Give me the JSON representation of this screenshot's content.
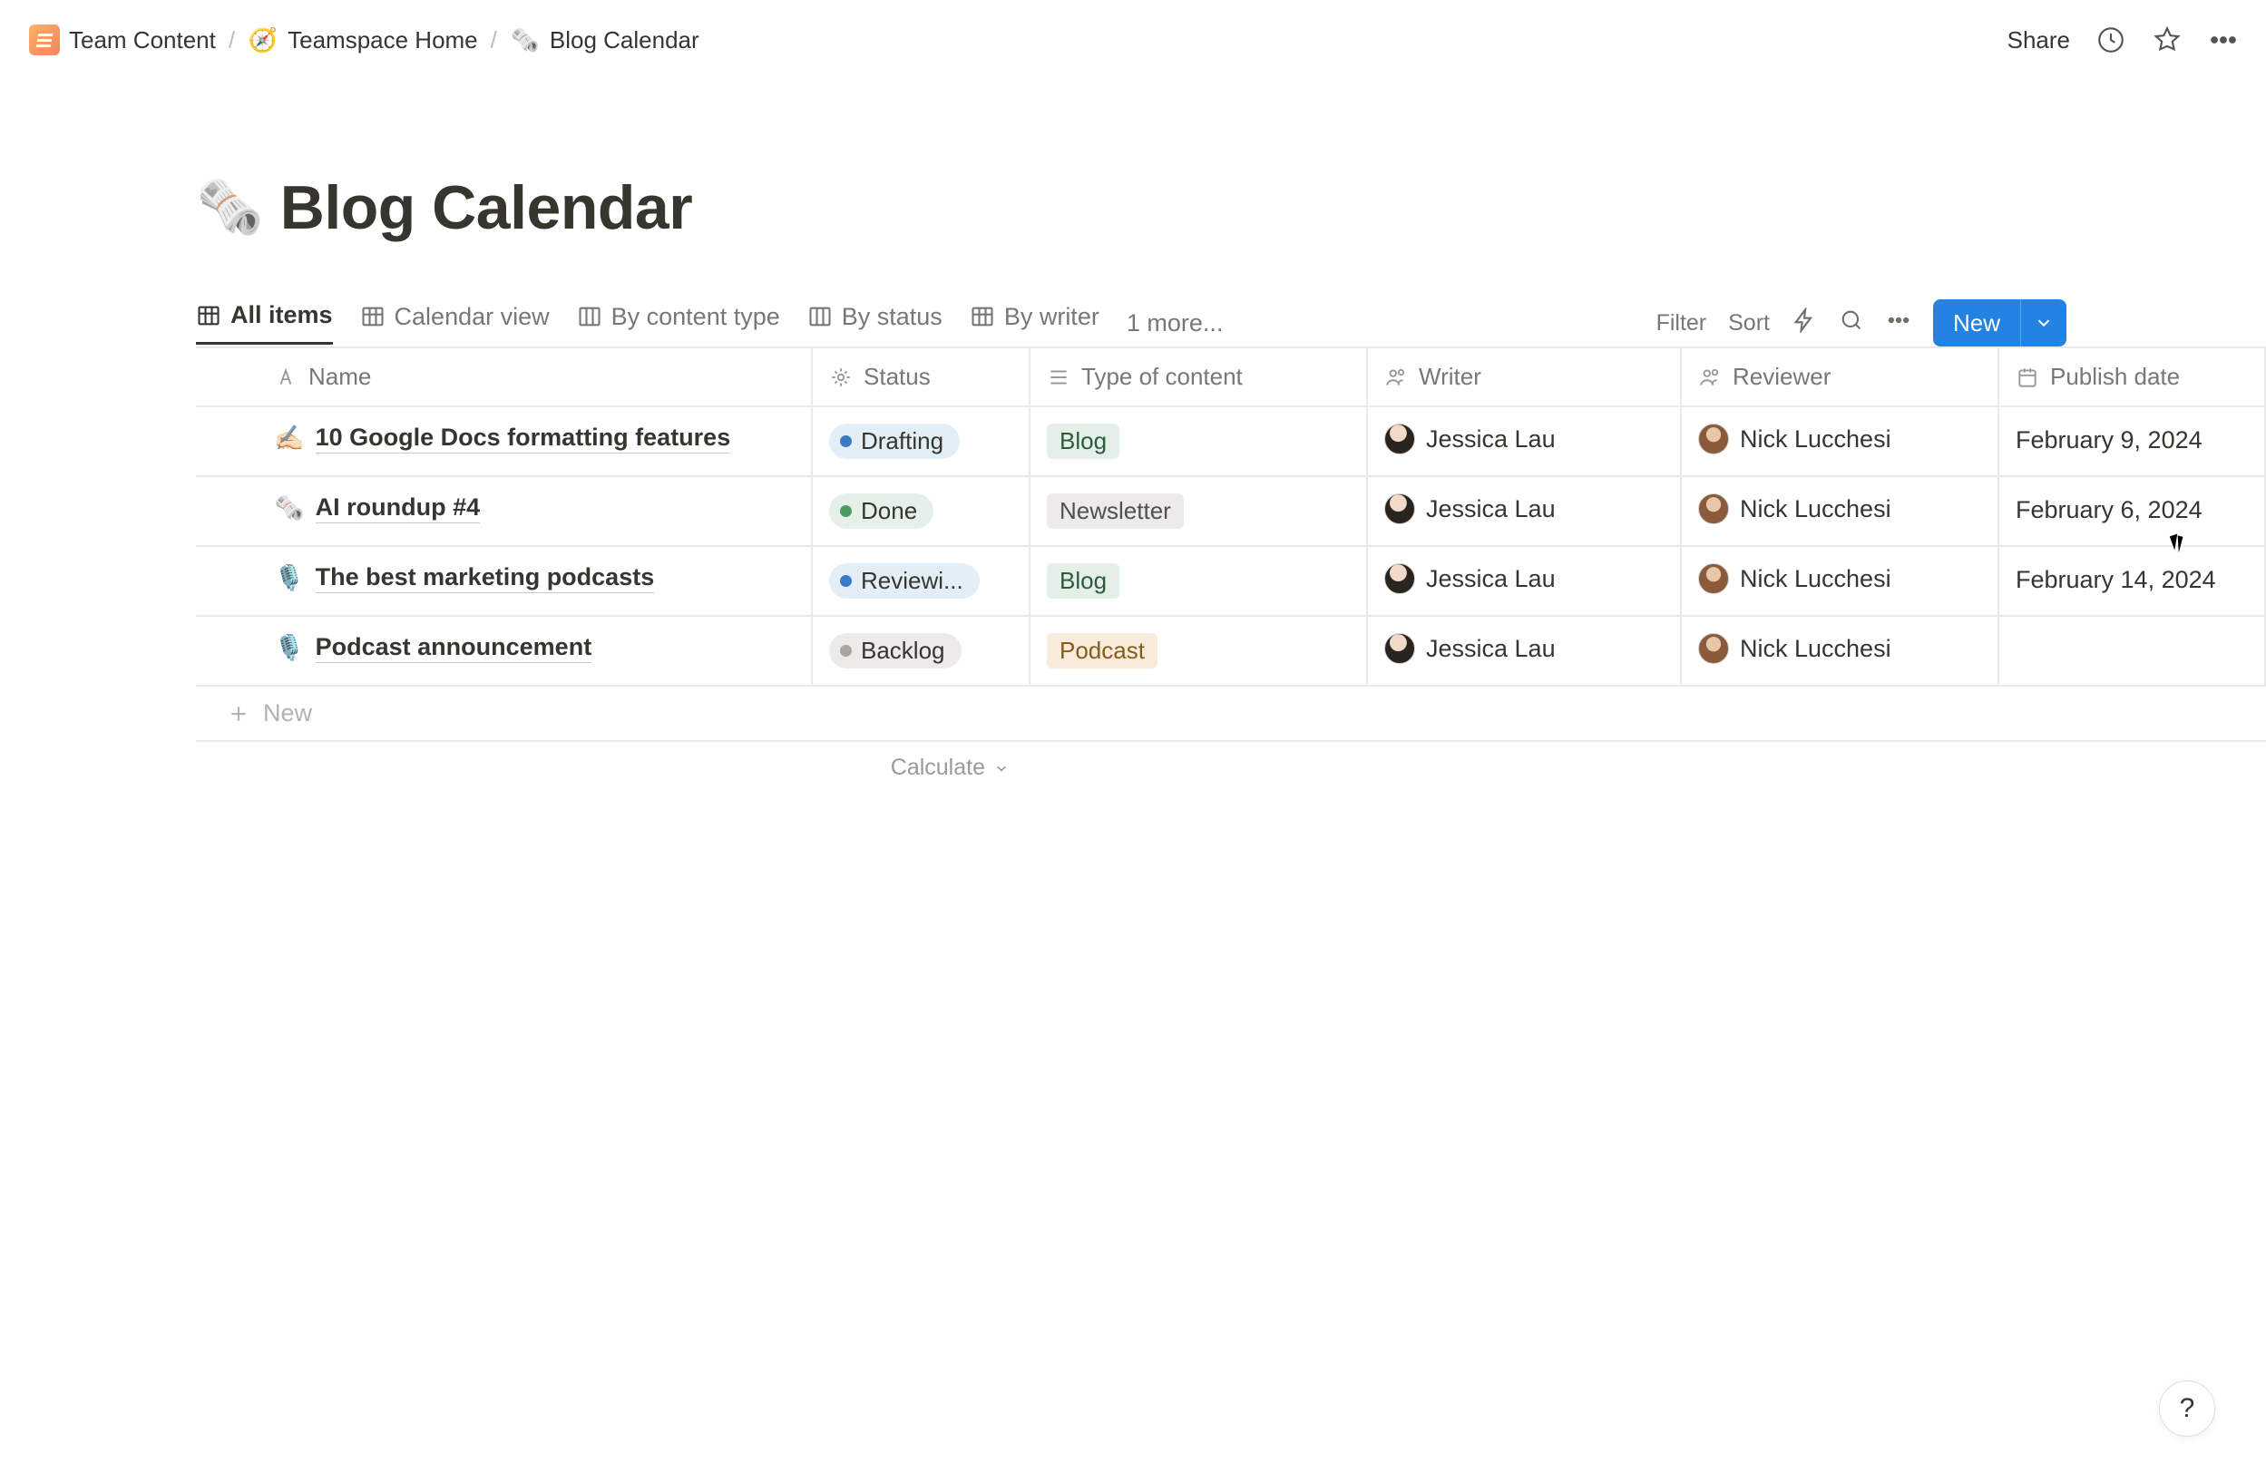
{
  "breadcrumb": {
    "items": [
      {
        "label": "Team Content",
        "icon": "workspace"
      },
      {
        "label": "Teamspace Home",
        "icon": "compass"
      },
      {
        "label": "Blog Calendar",
        "icon": "newspaper"
      }
    ]
  },
  "topbar": {
    "share": "Share"
  },
  "page": {
    "emoji": "🗞️",
    "title": "Blog Calendar"
  },
  "views": {
    "tabs": [
      {
        "label": "All items",
        "icon": "table",
        "active": true
      },
      {
        "label": "Calendar view",
        "icon": "table",
        "active": false
      },
      {
        "label": "By content type",
        "icon": "board",
        "active": false
      },
      {
        "label": "By status",
        "icon": "board",
        "active": false
      },
      {
        "label": "By writer",
        "icon": "table",
        "active": false
      }
    ],
    "more": "1 more..."
  },
  "controls": {
    "filter": "Filter",
    "sort": "Sort",
    "new": "New"
  },
  "columns": {
    "name": "Name",
    "status": "Status",
    "type": "Type of content",
    "writer": "Writer",
    "reviewer": "Reviewer",
    "publish": "Publish date"
  },
  "rows": [
    {
      "emoji": "✍🏻",
      "title": "10 Google Docs formatting features",
      "status": {
        "label": "Drafting",
        "class": "drafting"
      },
      "type": {
        "label": "Blog",
        "class": "blog"
      },
      "writer": {
        "name": "Jessica Lau",
        "avatar": "jl"
      },
      "reviewer": {
        "name": "Nick Lucchesi",
        "avatar": "nl"
      },
      "publish": "February 9, 2024"
    },
    {
      "emoji": "🗞️",
      "title": "AI roundup #4",
      "status": {
        "label": "Done",
        "class": "done"
      },
      "type": {
        "label": "Newsletter",
        "class": "newsletter"
      },
      "writer": {
        "name": "Jessica Lau",
        "avatar": "jl"
      },
      "reviewer": {
        "name": "Nick Lucchesi",
        "avatar": "nl"
      },
      "publish": "February 6, 2024"
    },
    {
      "emoji": "🎙️",
      "title": "The best marketing podcasts",
      "status": {
        "label": "Reviewi...",
        "class": "reviewing"
      },
      "type": {
        "label": "Blog",
        "class": "blog"
      },
      "writer": {
        "name": "Jessica Lau",
        "avatar": "jl"
      },
      "reviewer": {
        "name": "Nick Lucchesi",
        "avatar": "nl"
      },
      "publish": "February 14, 2024"
    },
    {
      "emoji": "🎙️",
      "title": "Podcast announcement",
      "status": {
        "label": "Backlog",
        "class": "backlog"
      },
      "type": {
        "label": "Podcast",
        "class": "podcast"
      },
      "writer": {
        "name": "Jessica Lau",
        "avatar": "jl"
      },
      "reviewer": {
        "name": "Nick Lucchesi",
        "avatar": "nl"
      },
      "publish": ""
    }
  ],
  "newrow": "New",
  "calculate": "Calculate",
  "help": "?"
}
